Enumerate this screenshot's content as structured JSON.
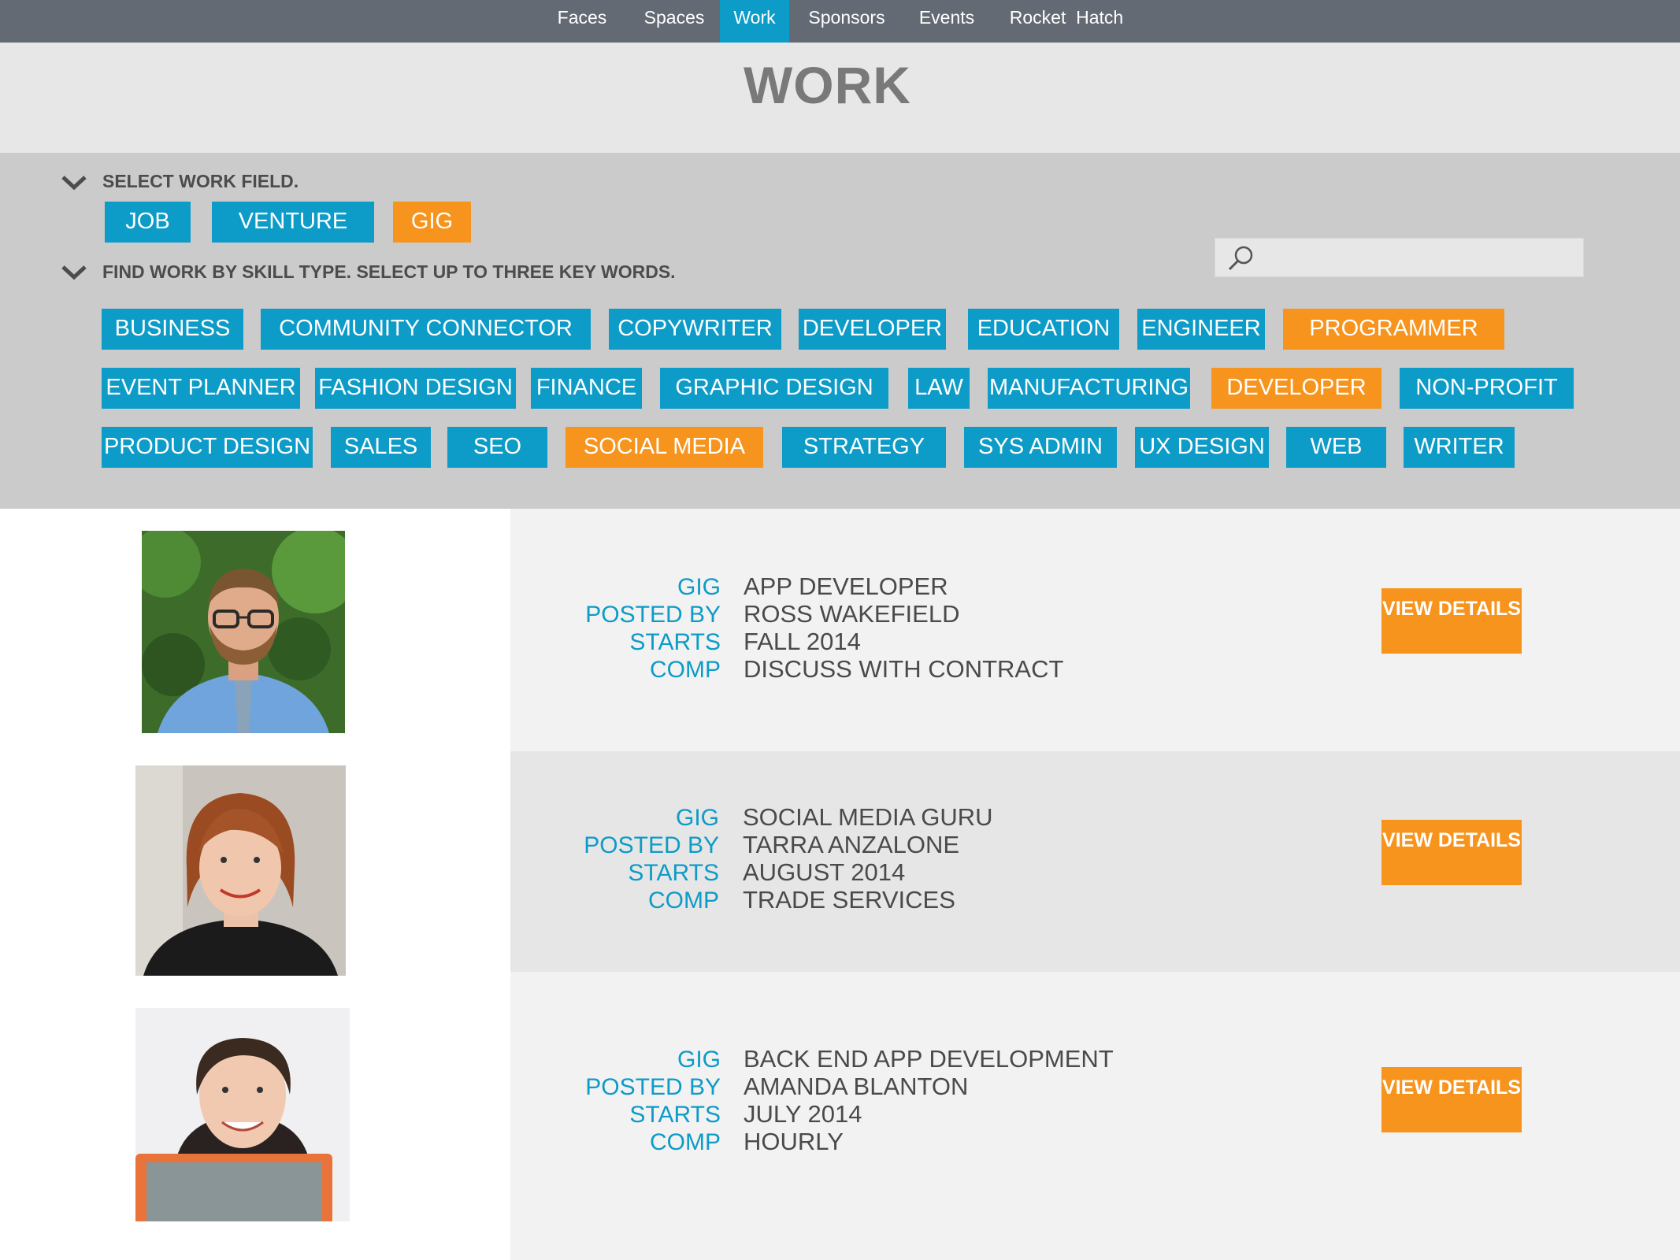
{
  "nav": {
    "items": [
      "Faces",
      "Spaces",
      "Work",
      "Sponsors",
      "Events",
      "Rocket  Hatch"
    ],
    "active": "Work"
  },
  "page": {
    "title": "WORK"
  },
  "filters": {
    "field_label": "SELECT WORK FIELD.",
    "fields": [
      {
        "label": "JOB",
        "selected": false
      },
      {
        "label": "VENTURE",
        "selected": false
      },
      {
        "label": "GIG",
        "selected": true
      }
    ],
    "skill_label": "FIND WORK BY SKILL TYPE. SELECT UP TO THREE KEY WORDS.",
    "skills_row1": [
      {
        "label": "BUSINESS",
        "selected": false
      },
      {
        "label": "COMMUNITY CONNECTOR",
        "selected": false
      },
      {
        "label": "COPYWRITER",
        "selected": false
      },
      {
        "label": "DEVELOPER",
        "selected": false
      },
      {
        "label": "EDUCATION",
        "selected": false
      },
      {
        "label": "ENGINEER",
        "selected": false
      },
      {
        "label": "PROGRAMMER",
        "selected": true
      }
    ],
    "skills_row2": [
      {
        "label": "EVENT PLANNER",
        "selected": false
      },
      {
        "label": "FASHION DESIGN",
        "selected": false
      },
      {
        "label": "FINANCE",
        "selected": false
      },
      {
        "label": "GRAPHIC DESIGN",
        "selected": false
      },
      {
        "label": "LAW",
        "selected": false
      },
      {
        "label": "MANUFACTURING",
        "selected": false
      },
      {
        "label": "DEVELOPER",
        "selected": true
      },
      {
        "label": "NON-PROFIT",
        "selected": false
      }
    ],
    "skills_row3": [
      {
        "label": "PRODUCT DESIGN",
        "selected": false
      },
      {
        "label": "SALES",
        "selected": false
      },
      {
        "label": "SEO",
        "selected": false
      },
      {
        "label": "SOCIAL MEDIA",
        "selected": true
      },
      {
        "label": "STRATEGY",
        "selected": false
      },
      {
        "label": "SYS ADMIN",
        "selected": false
      },
      {
        "label": "UX DESIGN",
        "selected": false
      },
      {
        "label": "WEB",
        "selected": false
      },
      {
        "label": "WRITER",
        "selected": false
      }
    ],
    "search_placeholder": ""
  },
  "labels": {
    "type": "GIG",
    "posted_by": "POSTED BY",
    "starts": "STARTS",
    "comp": "COMP",
    "view_details": "VIEW DETAILS"
  },
  "listings": [
    {
      "title": "APP DEVELOPER",
      "posted_by": "ROSS WAKEFIELD",
      "starts": "FALL 2014",
      "comp": "DISCUSS WITH CONTRACT"
    },
    {
      "title": "SOCIAL MEDIA GURU",
      "posted_by": "TARRA ANZALONE",
      "starts": "AUGUST 2014",
      "comp": "TRADE SERVICES"
    },
    {
      "title": "BACK END APP DEVELOPMENT",
      "posted_by": "AMANDA BLANTON",
      "starts": "JULY 2014",
      "comp": "HOURLY"
    }
  ],
  "colors": {
    "nav_bg": "#646a73",
    "accent_blue": "#0d9bc8",
    "accent_orange": "#f7941e",
    "filter_bg": "#cbcbcb"
  },
  "icons": [
    "chevron-down-icon",
    "search-icon"
  ]
}
